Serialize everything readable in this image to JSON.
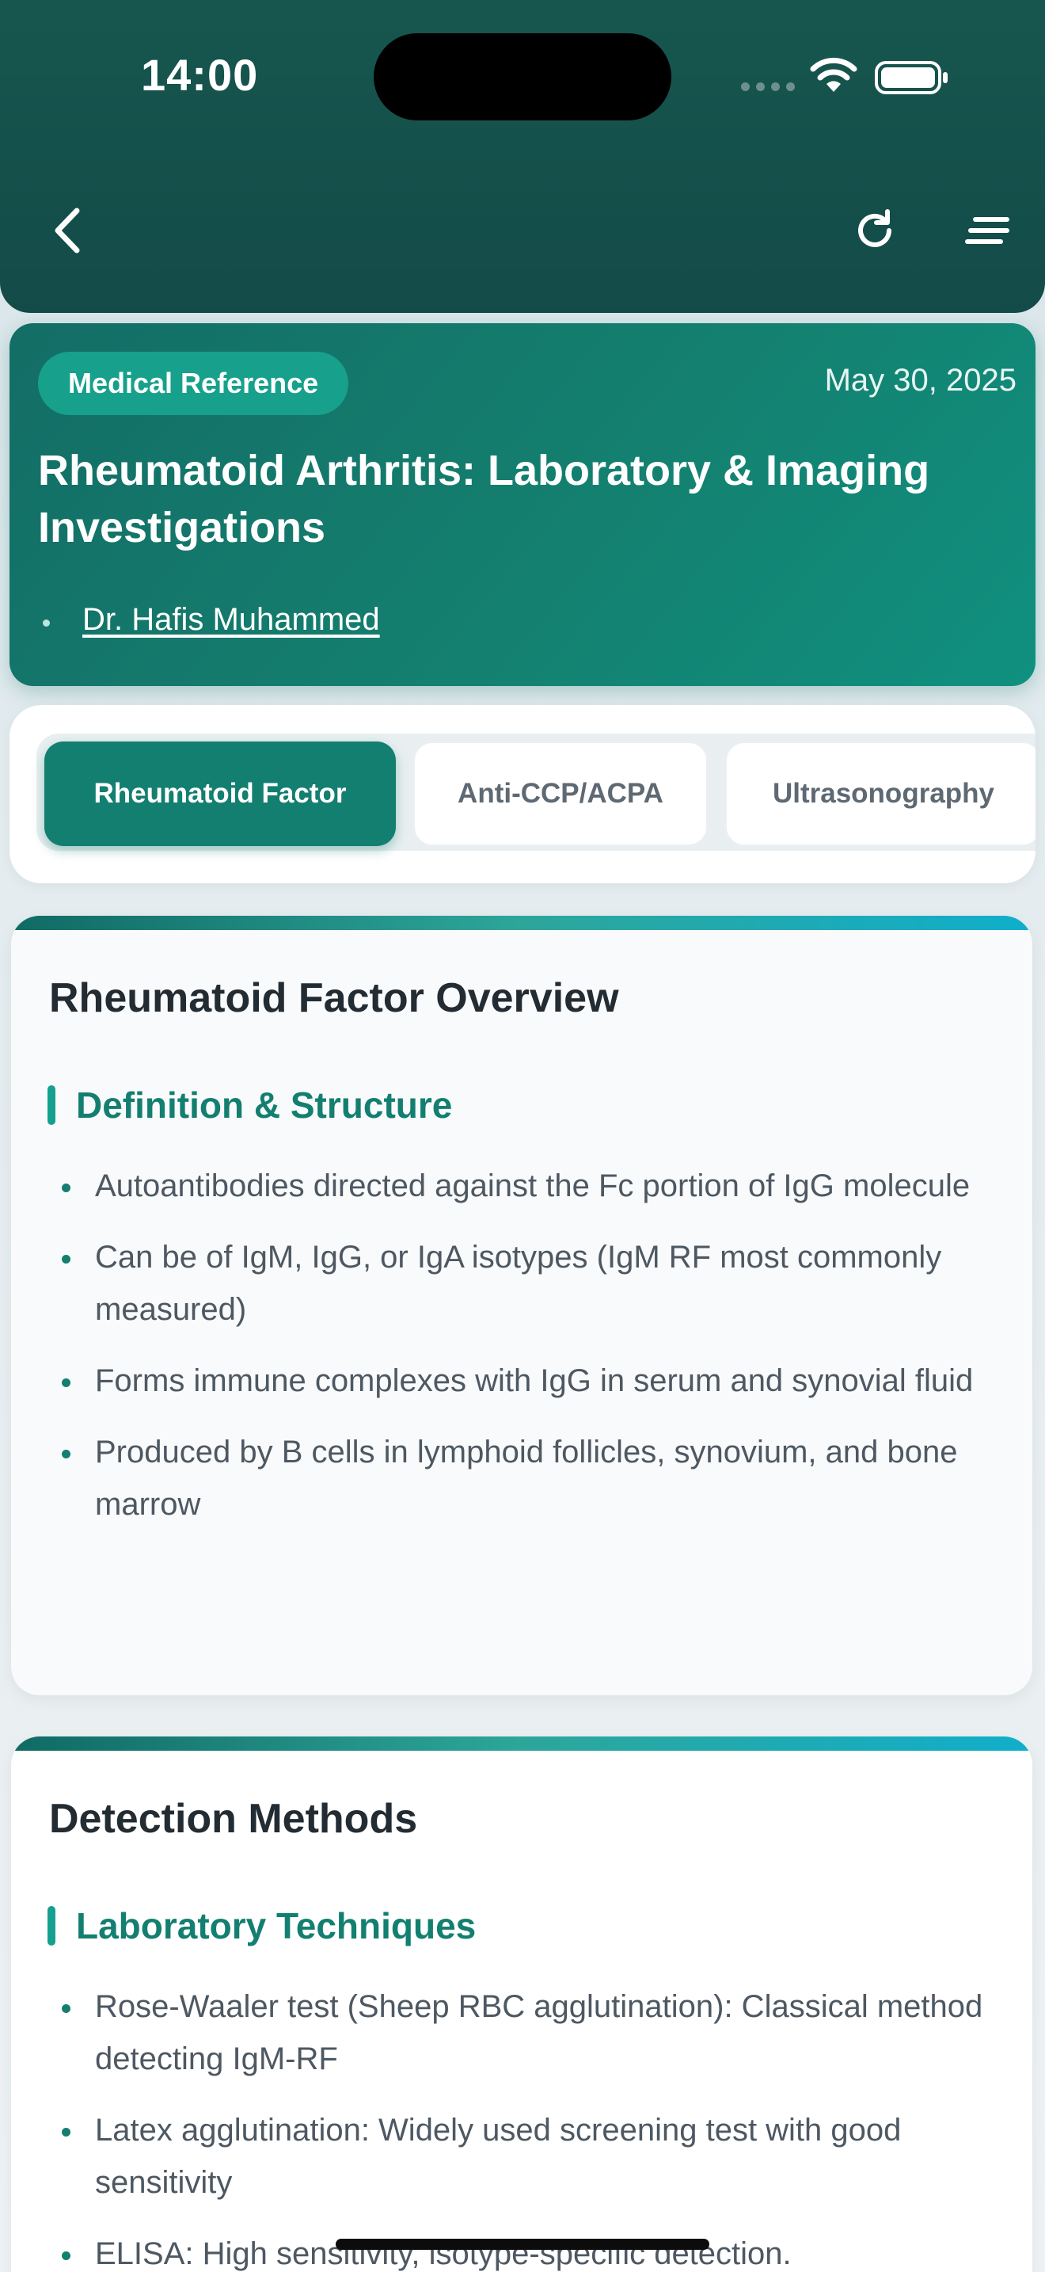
{
  "status_bar": {
    "time": "14:00"
  },
  "hero": {
    "badge": "Medical Reference",
    "date": "May 30, 2025",
    "title": "Rheumatoid Arthritis: Laboratory & Imaging Investigations",
    "author": "Dr. Hafis Muhammed"
  },
  "tabs": [
    {
      "label": "Rheumatoid Factor",
      "active": true
    },
    {
      "label": "Anti-CCP/ACPA",
      "active": false
    },
    {
      "label": "Ultrasonography",
      "active": false
    }
  ],
  "sections": [
    {
      "title": "Rheumatoid Factor Overview",
      "subheading": "Definition & Structure",
      "items": [
        "Autoantibodies directed against the Fc portion of IgG molecule",
        "Can be of IgM, IgG, or IgA isotypes (IgM RF most commonly measured)",
        "Forms immune complexes with IgG in serum and synovial fluid",
        "Produced by B cells in lymphoid follicles, synovium, and bone marrow"
      ]
    },
    {
      "title": "Detection Methods",
      "subheading": "Laboratory Techniques",
      "items": [
        "Rose-Waaler test (Sheep RBC agglutination): Classical method detecting IgM-RF",
        "Latex agglutination: Widely used screening test with good sensitivity",
        "ELISA: High sensitivity, isotype-specific detection."
      ]
    }
  ],
  "colors": {
    "header": "#134b48",
    "accent": "#137f70",
    "badge": "#17a08c",
    "text": "#232b33"
  },
  "icons": {
    "back": "chevron-left-icon",
    "refresh": "refresh-icon",
    "menu": "menu-lines-icon"
  }
}
